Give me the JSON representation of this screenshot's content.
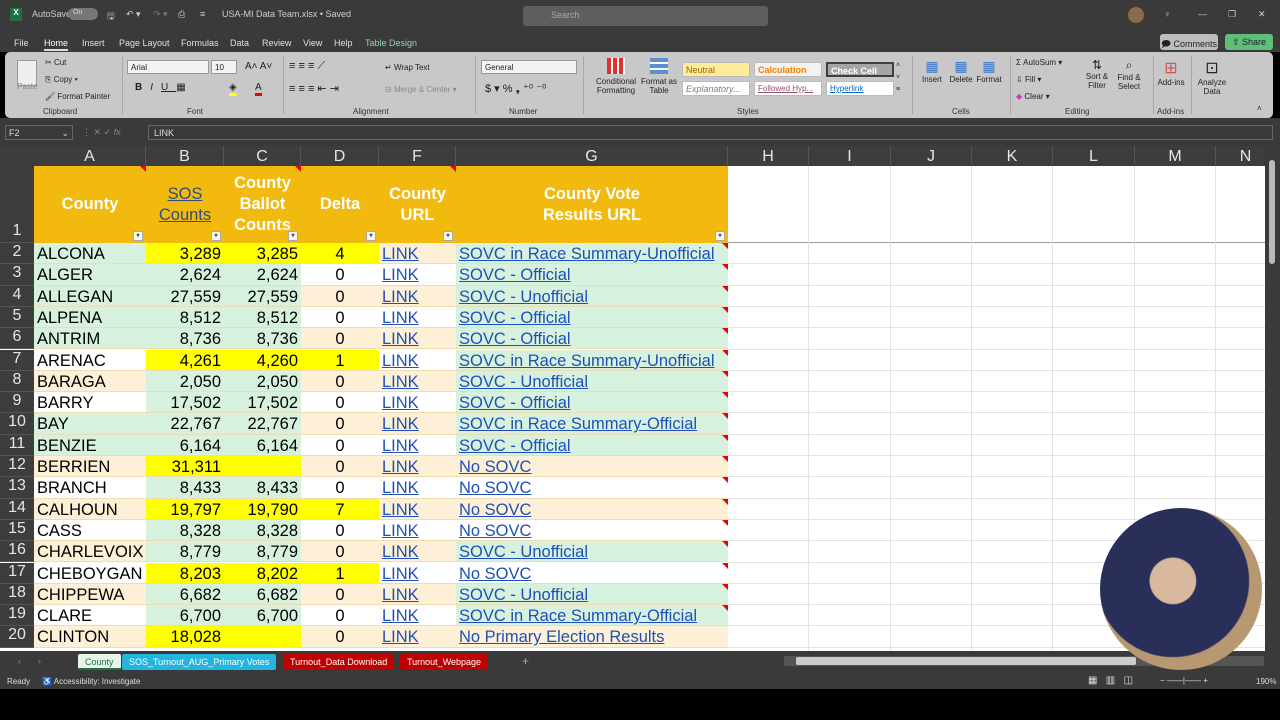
{
  "window": {
    "autosave_label": "AutoSave",
    "autosave_state": "On",
    "title": "USA-MI Data Team.xlsx • Saved",
    "search_placeholder": "Search"
  },
  "menu": [
    "File",
    "Home",
    "Insert",
    "Page Layout",
    "Formulas",
    "Data",
    "Review",
    "View",
    "Help",
    "Table Design"
  ],
  "menu_active": "Home",
  "header_buttons": {
    "comments": "Comments",
    "share": "Share"
  },
  "ribbon": {
    "clipboard": {
      "paste": "Paste",
      "cut": "Cut",
      "copy": "Copy",
      "format_painter": "Format Painter",
      "label": "Clipboard"
    },
    "font": {
      "name": "Arial",
      "size": "10",
      "label": "Font"
    },
    "alignment": {
      "wrap_text": "Wrap Text",
      "merge_center": "Merge & Center",
      "label": "Alignment"
    },
    "number": {
      "format": "General",
      "label": "Number"
    },
    "styles": {
      "conditional": "Conditional Formatting",
      "format_table": "Format as Table",
      "neutral": "Neutral",
      "calculation": "Calculation",
      "check_cell": "Check Cell",
      "explanatory": "Explanatory...",
      "followed": "Followed Hyp...",
      "hyperlink": "Hyperlink",
      "label": "Styles"
    },
    "cells": {
      "insert": "Insert",
      "delete": "Delete",
      "format": "Format",
      "label": "Cells"
    },
    "editing": {
      "autosum": "AutoSum",
      "fill": "Fill",
      "clear": "Clear",
      "sort": "Sort & Filter",
      "find": "Find & Select",
      "label": "Editing"
    },
    "addins": {
      "addins": "Add-ins",
      "label": "Add-ins",
      "analyze": "Analyze Data"
    }
  },
  "formula_bar": {
    "name_box": "F2",
    "formula": "LINK"
  },
  "columns": [
    "A",
    "B",
    "C",
    "D",
    "F",
    "G",
    "H",
    "I",
    "J",
    "K",
    "L",
    "M",
    "N"
  ],
  "table_headers": {
    "A": "County",
    "B": "SOS Counts",
    "C": "County Ballot Counts",
    "D": "Delta",
    "F": "County URL",
    "G": "County Vote Results URL"
  },
  "rows": [
    {
      "n": "2",
      "county": "ALCONA",
      "sos": "3,289",
      "ballot": "3,285",
      "delta": "4",
      "url": "LINK",
      "results": "SOVC in Race Summary-Unofficial"
    },
    {
      "n": "3",
      "county": "ALGER",
      "sos": "2,624",
      "ballot": "2,624",
      "delta": "0",
      "url": "LINK",
      "results": "SOVC - Official"
    },
    {
      "n": "4",
      "county": "ALLEGAN",
      "sos": "27,559",
      "ballot": "27,559",
      "delta": "0",
      "url": "LINK",
      "results": "SOVC - Unofficial"
    },
    {
      "n": "5",
      "county": "ALPENA",
      "sos": "8,512",
      "ballot": "8,512",
      "delta": "0",
      "url": "LINK",
      "results": "SOVC - Official"
    },
    {
      "n": "6",
      "county": "ANTRIM",
      "sos": "8,736",
      "ballot": "8,736",
      "delta": "0",
      "url": "LINK",
      "results": "SOVC - Official"
    },
    {
      "n": "7",
      "county": "ARENAC",
      "sos": "4,261",
      "ballot": "4,260",
      "delta": "1",
      "url": "LINK",
      "results": "SOVC in Race Summary-Unofficial"
    },
    {
      "n": "8",
      "county": "BARAGA",
      "sos": "2,050",
      "ballot": "2,050",
      "delta": "0",
      "url": "LINK",
      "results": "SOVC - Unofficial"
    },
    {
      "n": "9",
      "county": "BARRY",
      "sos": "17,502",
      "ballot": "17,502",
      "delta": "0",
      "url": "LINK",
      "results": "SOVC - Official"
    },
    {
      "n": "10",
      "county": "BAY",
      "sos": "22,767",
      "ballot": "22,767",
      "delta": "0",
      "url": "LINK",
      "results": "SOVC in Race Summary-Official"
    },
    {
      "n": "11",
      "county": "BENZIE",
      "sos": "6,164",
      "ballot": "6,164",
      "delta": "0",
      "url": "LINK",
      "results": "SOVC - Official"
    },
    {
      "n": "12",
      "county": "BERRIEN",
      "sos": "31,311",
      "ballot": "",
      "delta": "0",
      "url": "LINK",
      "results": "No SOVC"
    },
    {
      "n": "13",
      "county": "BRANCH",
      "sos": "8,433",
      "ballot": "8,433",
      "delta": "0",
      "url": "LINK",
      "results": "No SOVC"
    },
    {
      "n": "14",
      "county": "CALHOUN",
      "sos": "19,797",
      "ballot": "19,790",
      "delta": "7",
      "url": "LINK",
      "results": "No SOVC"
    },
    {
      "n": "15",
      "county": "CASS",
      "sos": "8,328",
      "ballot": "8,328",
      "delta": "0",
      "url": "LINK",
      "results": "No SOVC"
    },
    {
      "n": "16",
      "county": "CHARLEVOIX",
      "sos": "8,779",
      "ballot": "8,779",
      "delta": "0",
      "url": "LINK",
      "results": "SOVC - Unofficial"
    },
    {
      "n": "17",
      "county": "CHEBOYGAN",
      "sos": "8,203",
      "ballot": "8,202",
      "delta": "1",
      "url": "LINK",
      "results": "No SOVC"
    },
    {
      "n": "18",
      "county": "CHIPPEWA",
      "sos": "6,682",
      "ballot": "6,682",
      "delta": "0",
      "url": "LINK",
      "results": "SOVC - Unofficial"
    },
    {
      "n": "19",
      "county": "CLARE",
      "sos": "6,700",
      "ballot": "6,700",
      "delta": "0",
      "url": "LINK",
      "results": "SOVC in Race Summary-Official"
    },
    {
      "n": "20",
      "county": "CLINTON",
      "sos": "18,028",
      "ballot": "",
      "delta": "0",
      "url": "LINK",
      "results": "No Primary Election Results"
    }
  ],
  "colors": {
    "header": "#f2b90f",
    "green": "#d6f2de",
    "beige": "#fdf0d6",
    "white": "#ffffff",
    "yellow": "#ffff00",
    "link": "#1f4fb8"
  },
  "sheet_tabs": [
    {
      "label": "County",
      "color": "#e8f5e9",
      "active": true
    },
    {
      "label": "SOS_Turnout_AUG_Primary Votes",
      "color": "#22b5e0"
    },
    {
      "label": "Turnout_Data Download",
      "color": "#c00000"
    },
    {
      "label": "Turnout_Webpage",
      "color": "#c00000"
    }
  ],
  "status": {
    "ready": "Ready",
    "accessibility": "Accessibility: Investigate",
    "zoom": "190%"
  }
}
